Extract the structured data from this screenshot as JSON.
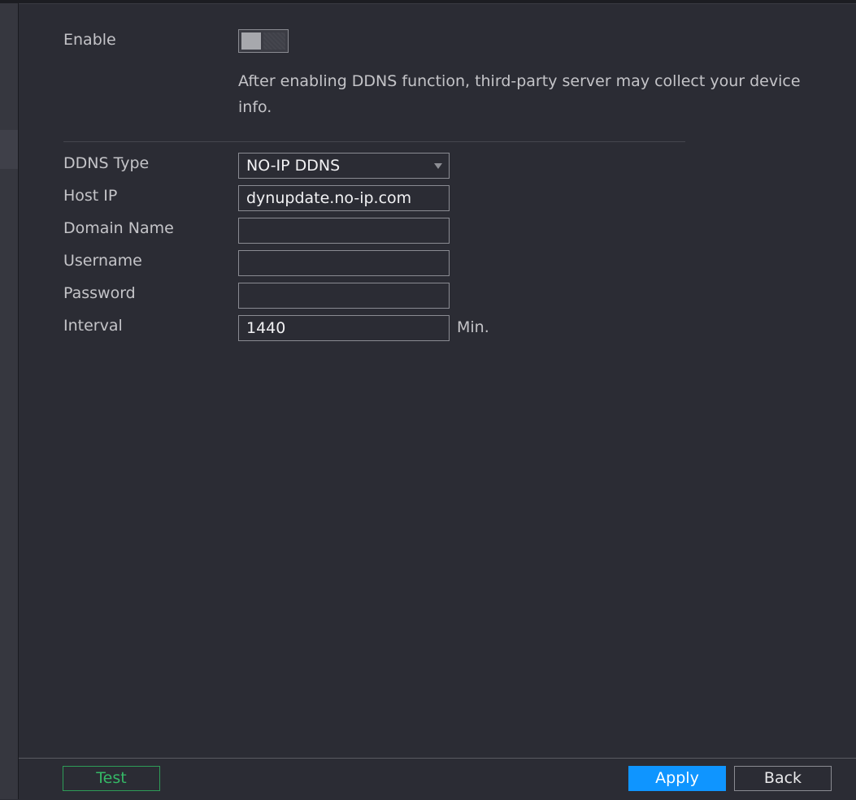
{
  "enable": {
    "label": "Enable",
    "toggle_state": "off",
    "notice": " After enabling DDNS function, third-party server may collect your device info."
  },
  "form": {
    "ddns_type": {
      "label": "DDNS Type",
      "value": "NO-IP DDNS"
    },
    "host_ip": {
      "label": "Host IP",
      "value": "dynupdate.no-ip.com"
    },
    "domain_name": {
      "label": "Domain Name",
      "value": ""
    },
    "username": {
      "label": "Username",
      "value": ""
    },
    "password": {
      "label": "Password",
      "value": ""
    },
    "interval": {
      "label": "Interval",
      "value": "1440",
      "unit": "Min."
    }
  },
  "buttons": {
    "test": "Test",
    "apply": "Apply",
    "back": "Back"
  },
  "colors": {
    "background": "#2b2c34",
    "accent": "#0f95ff",
    "test_green": "#35b866"
  }
}
